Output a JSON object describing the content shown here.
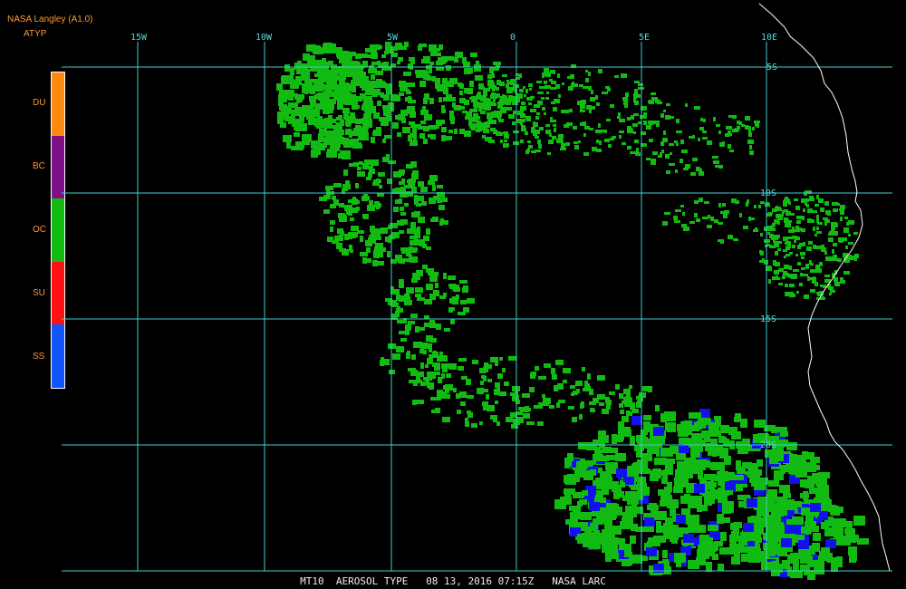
{
  "header": {
    "source": "NASA Langley (A1.0)",
    "product": "ATYP"
  },
  "legend": [
    {
      "code": "DU",
      "color": "#ff8811"
    },
    {
      "code": "BC",
      "color": "#7f1188"
    },
    {
      "code": "OC",
      "color": "#11bb11"
    },
    {
      "code": "SU",
      "color": "#ff1111"
    },
    {
      "code": "SS",
      "color": "#1155ff"
    }
  ],
  "grid": {
    "lon_labels": [
      "15W",
      "10W",
      "5W",
      "0",
      "5E",
      "10E"
    ],
    "lat_labels": [
      "5S",
      "10S",
      "15S",
      "20S"
    ]
  },
  "colors": {
    "grid": "#44cccc",
    "coast": "#ffffff",
    "aerosol_oc": "#11bb11",
    "aerosol_ss": "#1111ee"
  },
  "footer": "MT10  AEROSOL TYPE   08 13, 2016 07:15Z   NASA LARC"
}
